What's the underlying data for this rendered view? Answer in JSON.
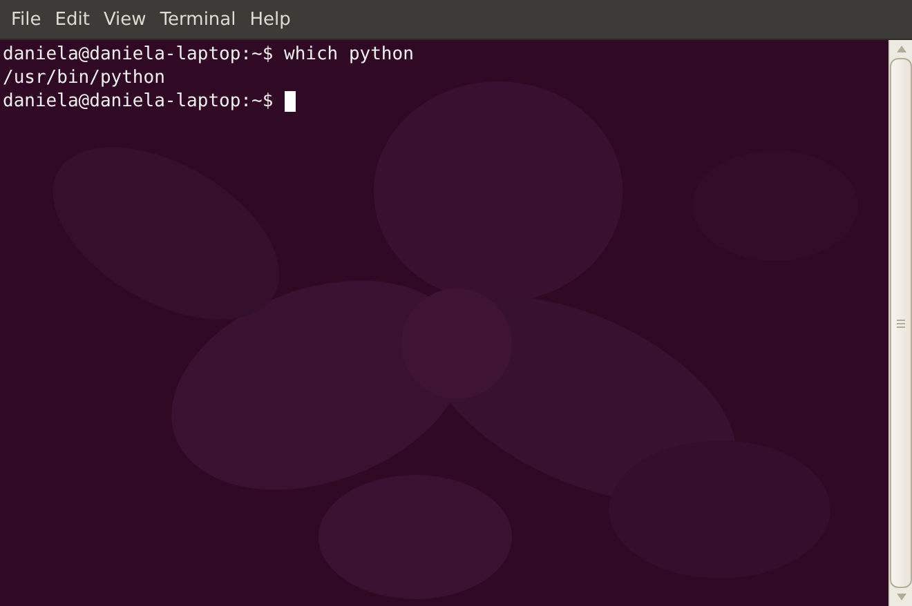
{
  "menu": [
    "File",
    "Edit",
    "View",
    "Terminal",
    "Help"
  ],
  "terminal": {
    "lines": [
      {
        "text": "daniela@daniela-laptop:~$ which python",
        "cursor": false
      },
      {
        "text": "/usr/bin/python",
        "cursor": false
      },
      {
        "text": "daniela@daniela-laptop:~$ ",
        "cursor": true
      }
    ]
  }
}
